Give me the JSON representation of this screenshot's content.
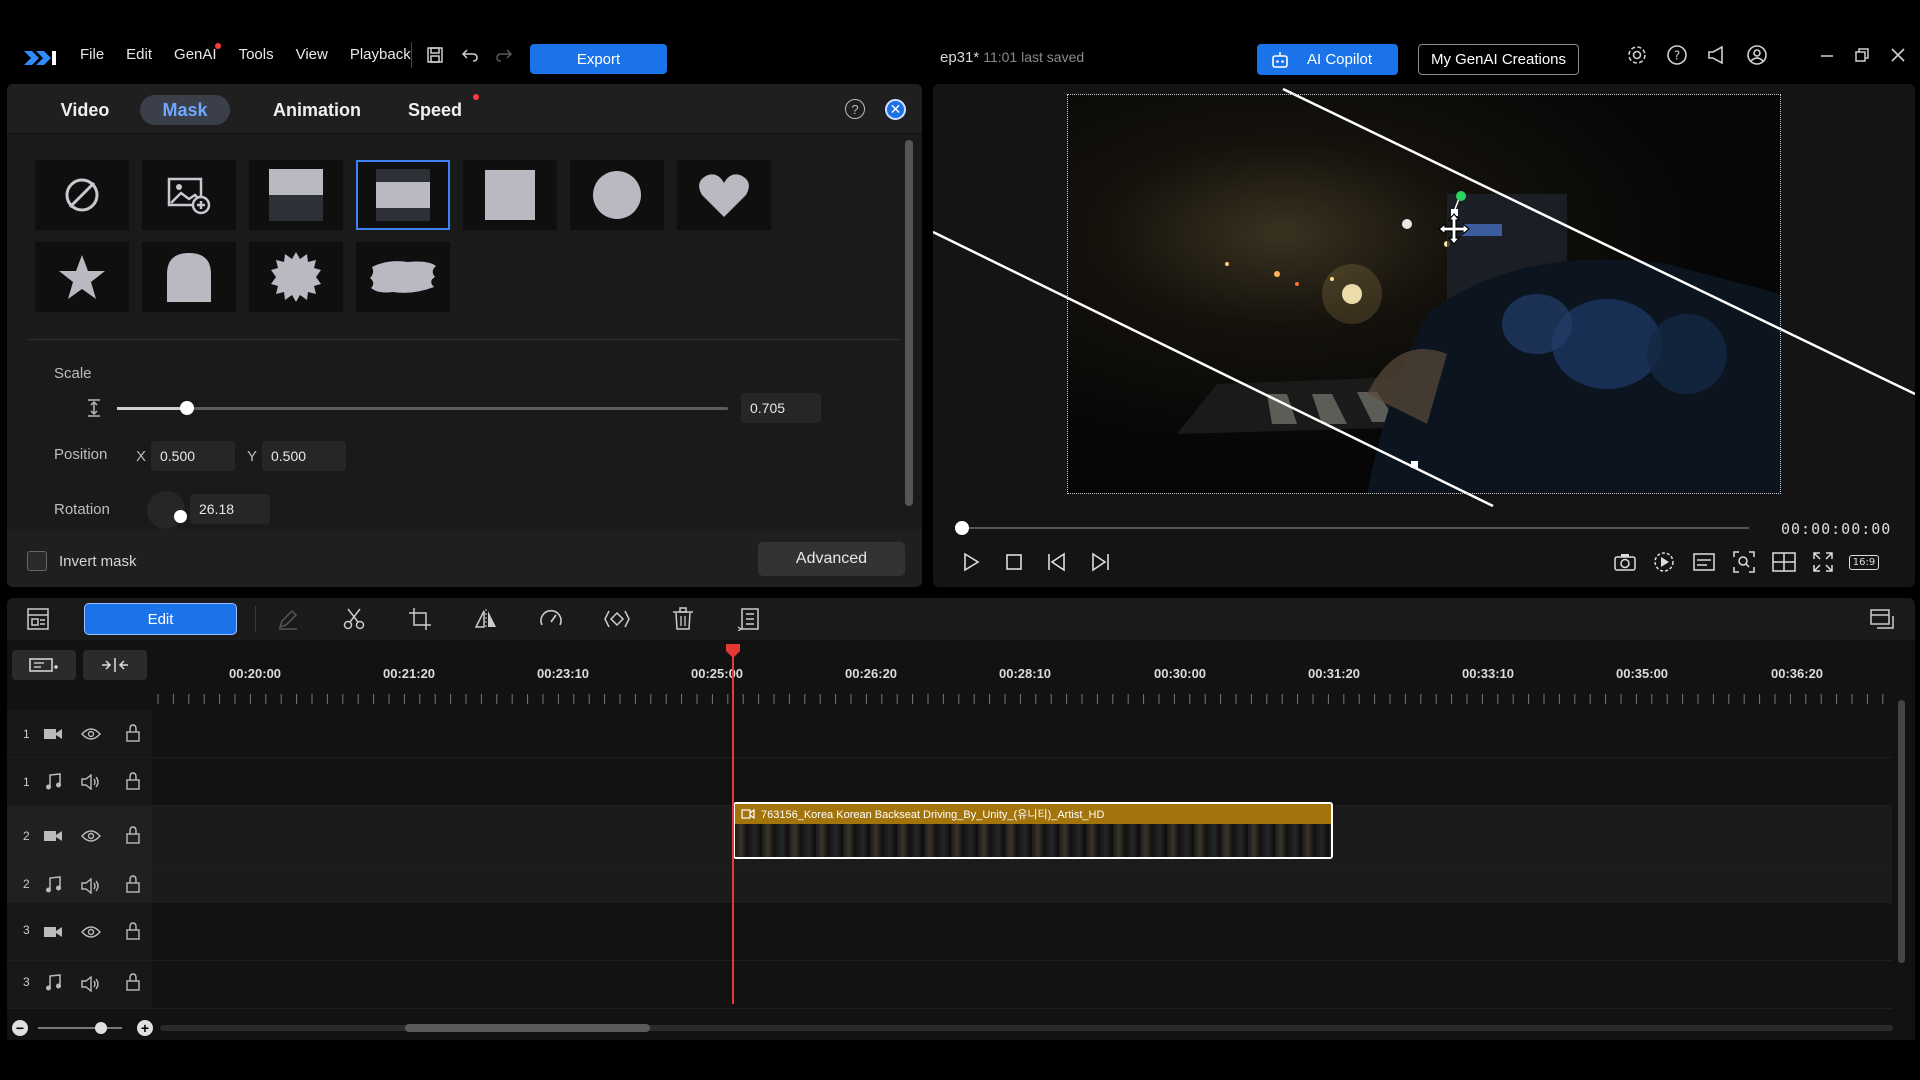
{
  "menu": {
    "items": [
      "File",
      "Edit",
      "GenAI",
      "Tools",
      "View",
      "Playback"
    ],
    "export_label": "Export"
  },
  "project": {
    "name": "ep31*",
    "saved_status": "11:01 last saved"
  },
  "top_right": {
    "copilot_label": "AI Copilot",
    "genai_creations_label": "My GenAI Creations"
  },
  "panel": {
    "tabs": [
      "Video",
      "Mask",
      "Animation",
      "Speed"
    ],
    "active_tab": "Mask",
    "help_glyph": "?",
    "close_glyph": "✕",
    "mask_shapes": [
      "none",
      "image-mask",
      "linear-top",
      "linear-band",
      "rectangle",
      "circle",
      "heart",
      "star",
      "arch",
      "starburst",
      "brush"
    ],
    "selected_shape": "linear-band",
    "scale_label": "Scale",
    "scale_value": "0.705",
    "position_label": "Position",
    "x_label": "X",
    "x_value": "0.500",
    "y_label": "Y",
    "y_value": "0.500",
    "rotation_label": "Rotation",
    "rotation_value": "26.18",
    "invert_label": "Invert mask",
    "advanced_label": "Advanced"
  },
  "preview": {
    "timecode": "00:00:00:00",
    "aspect_label": "16:9"
  },
  "timeline_toolbar": {
    "edit_label": "Edit"
  },
  "timeline": {
    "ruler": [
      "00:20:00",
      "00:21:20",
      "00:23:10",
      "00:25:00",
      "00:26:20",
      "00:28:10",
      "00:30:00",
      "00:31:20",
      "00:33:10",
      "00:35:00",
      "00:36:20"
    ],
    "tracks": [
      {
        "num": "1",
        "type": "video"
      },
      {
        "num": "1",
        "type": "audio"
      },
      {
        "num": "2",
        "type": "video"
      },
      {
        "num": "2",
        "type": "audio"
      },
      {
        "num": "3",
        "type": "video"
      },
      {
        "num": "3",
        "type": "audio"
      }
    ],
    "clip_name": "763156_Korea Korean Backseat Driving_By_Unity_(유니티)_Artist_HD"
  },
  "colors": {
    "accent": "#1a73e8",
    "clip": "#a3740c",
    "playhead": "#e53935"
  }
}
